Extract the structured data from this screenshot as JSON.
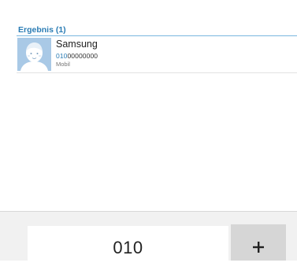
{
  "results": {
    "header": "Ergebnis (1)"
  },
  "contact": {
    "name": "Samsung",
    "number_match": "010",
    "number_rest": "00000000",
    "type": "Mobil",
    "avatar_icon": "default-contact-avatar-icon"
  },
  "dialer": {
    "entered_number": "010",
    "add_button_icon": "plus-icon"
  },
  "colors": {
    "accent": "#2a7cb4",
    "avatar_bg": "#a9c9e6",
    "panel_bg": "#f1f1f1",
    "button_bg": "#d6d6d6"
  }
}
